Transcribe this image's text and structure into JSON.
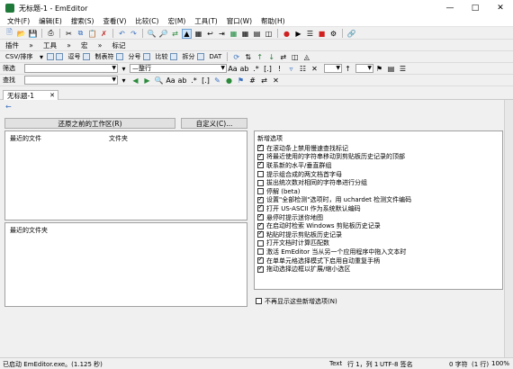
{
  "window": {
    "title": "无标题-1 - EmEditor",
    "controls": [
      "minimize-icon",
      "maximize-icon",
      "close-icon"
    ]
  },
  "menu": [
    "文件(F)",
    "编辑(E)",
    "搜索(S)",
    "查看(V)",
    "比较(C)",
    "宏(M)",
    "工具(T)",
    "窗口(W)",
    "帮助(H)"
  ],
  "plugins_bar": {
    "plugins": "插件",
    "tools": "工具",
    "macros": "宏",
    "markers": "标记"
  },
  "csv_bar": {
    "label": "CSV/排序",
    "items": [
      "逗号",
      "制表符",
      "分号",
      "比较",
      "拆分",
      "DAT"
    ]
  },
  "filter_bar": {
    "label": "筛选",
    "mode": "—整行"
  },
  "find_bar": {
    "label": "查找"
  },
  "tab": {
    "label": "无标题-1"
  },
  "start": {
    "back_arrow": "←",
    "restore_button": "还原之前的工作区(R)",
    "customize_button": "自定义(C)...",
    "recent_files_header": "最近的文件",
    "folder_header": "文件夹",
    "recent_folders_header": "最近的文件夹",
    "new_options_header": "新增选项",
    "options": [
      {
        "label": "在滚动条上禁用慢速查找标记",
        "checked": true
      },
      {
        "label": "将最近使用的字符串移动到剪贴板历史记录的顶部",
        "checked": true
      },
      {
        "label": "联系新的水平/垂直群组",
        "checked": true
      },
      {
        "label": "提示组合成的两文档首字母",
        "checked": false
      },
      {
        "label": "拔出统次数对相同的字符串进行分组",
        "checked": false
      },
      {
        "label": "停解 (beta)",
        "checked": false
      },
      {
        "label": "设置\"全部检测\"选项时，用 uchardet 检测文件编码",
        "checked": true
      },
      {
        "label": "打开 US-ASCII 作为系统默认编码",
        "checked": true
      },
      {
        "label": "悬停时提示迷你地图",
        "checked": true
      },
      {
        "label": "在启动时检索 Windows 剪贴板历史记录",
        "checked": true
      },
      {
        "label": "粘贴时提示剪贴板历史记录",
        "checked": true
      },
      {
        "label": "打开文档时计算匹配数",
        "checked": false
      },
      {
        "label": "激活 EmEditor 当从另一个应用程序中拖入文本时",
        "checked": false
      },
      {
        "label": "在单单元格选择模式下启用自动重复手柄",
        "checked": true
      },
      {
        "label": "拖动选择边框以扩展/缩小选区",
        "checked": true
      }
    ],
    "dont_show": "不再显示这些新增选项(N)"
  },
  "status": {
    "left": "已启动 EmEditor.exe。(1.125 秒)",
    "mode": "Text",
    "position": "行 1，列 1",
    "encoding": "UTF-8 签名",
    "chars": "0 字符",
    "lines": "(1 行)",
    "zoom": "100%"
  }
}
